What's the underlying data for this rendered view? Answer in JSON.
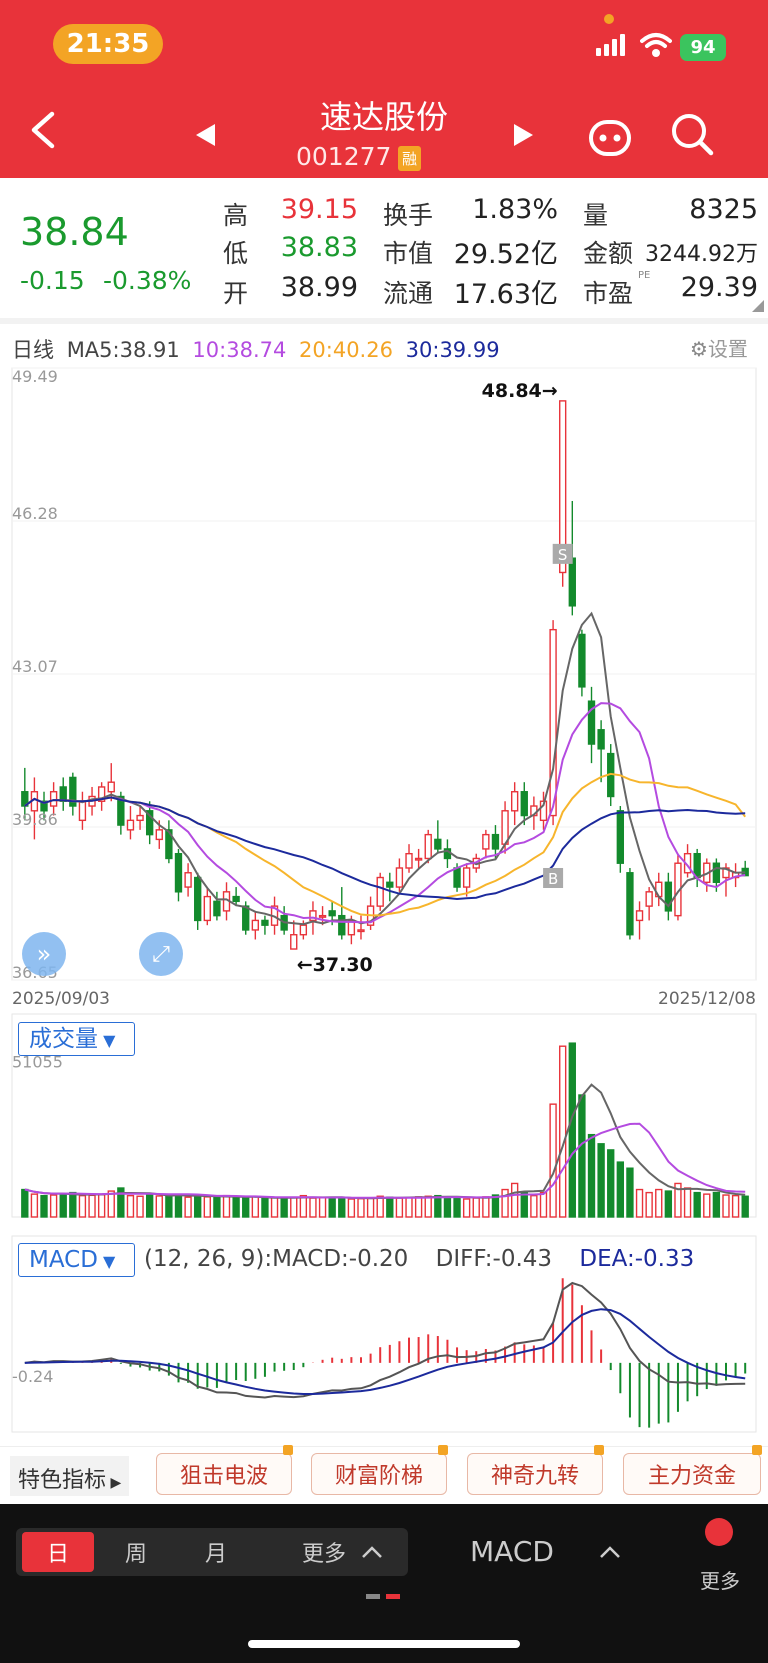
{
  "status": {
    "time": "21:35",
    "battery": "94"
  },
  "header": {
    "title": "速达股份",
    "code": "001277",
    "margin_badge": "融"
  },
  "quote": {
    "price": "38.84",
    "change": "-0.15",
    "change_pct": "-0.38%",
    "high_label": "高",
    "high": "39.15",
    "low_label": "低",
    "low": "38.83",
    "open_label": "开",
    "open": "38.99",
    "turnover_label": "换手",
    "turnover": "1.83%",
    "mktcap_label": "市值",
    "mktcap": "29.52亿",
    "float_label": "流通",
    "float": "17.63亿",
    "vol_label": "量",
    "vol": "8325",
    "amount_label": "金额",
    "amount": "3244.92万",
    "pe_label": "市盈",
    "pe_sup": "PE",
    "pe": "29.39"
  },
  "ma_legend": {
    "period": "日线",
    "ma5": "MA5:38.91",
    "ma10": "10:38.74",
    "ma20": "20:40.26",
    "ma30": "30:39.99",
    "settings": "设置"
  },
  "colors": {
    "up": "#e8333a",
    "down": "#138a2c",
    "ma5": "#666666",
    "ma10": "#b44be0",
    "ma20": "#f7b52c",
    "ma30": "#1c2a9c",
    "diff": "#555555",
    "dea": "#1c2a9c"
  },
  "chart_data": {
    "type": "candlestick",
    "y_ticks": [
      "49.49",
      "46.28",
      "43.07",
      "39.86",
      "36.65"
    ],
    "ylim": [
      36.65,
      49.49
    ],
    "x_start": "2025/09/03",
    "x_end": "2025/12/08",
    "high_mark": "48.84→",
    "low_mark": "←37.30",
    "sell_marker": "S",
    "buy_marker": "B",
    "candles": [
      [
        40.6,
        40.3,
        41.1,
        40.0
      ],
      [
        40.2,
        40.6,
        40.9,
        39.6
      ],
      [
        40.4,
        40.2,
        40.6,
        40.0
      ],
      [
        40.3,
        40.6,
        40.8,
        40.1
      ],
      [
        40.7,
        40.4,
        40.9,
        40.2
      ],
      [
        40.9,
        40.3,
        41.0,
        40.1
      ],
      [
        40.0,
        40.4,
        40.6,
        39.8
      ],
      [
        40.3,
        40.5,
        40.7,
        40.1
      ],
      [
        40.4,
        40.7,
        40.8,
        40.2
      ],
      [
        40.6,
        40.8,
        41.2,
        40.4
      ],
      [
        40.5,
        39.9,
        40.6,
        39.7
      ],
      [
        39.8,
        40.0,
        40.3,
        39.6
      ],
      [
        40.0,
        40.1,
        40.3,
        39.8
      ],
      [
        40.2,
        39.7,
        40.4,
        39.5
      ],
      [
        39.6,
        39.8,
        40.0,
        39.4
      ],
      [
        39.8,
        39.2,
        40.0,
        39.1
      ],
      [
        39.3,
        38.5,
        39.4,
        38.3
      ],
      [
        38.6,
        38.9,
        39.1,
        38.4
      ],
      [
        38.8,
        37.9,
        38.9,
        37.7
      ],
      [
        37.9,
        38.4,
        38.6,
        37.8
      ],
      [
        38.3,
        38.0,
        38.5,
        37.9
      ],
      [
        38.1,
        38.5,
        38.7,
        37.9
      ],
      [
        38.4,
        38.3,
        38.6,
        38.2
      ],
      [
        38.2,
        37.7,
        38.3,
        37.6
      ],
      [
        37.7,
        37.9,
        38.1,
        37.5
      ],
      [
        37.9,
        37.8,
        38.0,
        37.6
      ],
      [
        37.8,
        38.2,
        38.4,
        37.6
      ],
      [
        38.0,
        37.7,
        38.2,
        37.6
      ],
      [
        37.3,
        37.6,
        37.9,
        37.3
      ],
      [
        37.6,
        37.8,
        37.9,
        37.5
      ],
      [
        37.9,
        38.1,
        38.3,
        37.6
      ],
      [
        38.0,
        38.0,
        38.2,
        37.8
      ],
      [
        38.1,
        38.0,
        38.3,
        37.8
      ],
      [
        38.0,
        37.6,
        38.6,
        37.5
      ],
      [
        37.6,
        37.9,
        38.0,
        37.4
      ],
      [
        37.7,
        37.7,
        38.0,
        37.5
      ],
      [
        37.8,
        38.2,
        38.4,
        37.7
      ],
      [
        38.2,
        38.8,
        38.9,
        38.1
      ],
      [
        38.7,
        38.6,
        38.9,
        38.3
      ],
      [
        38.6,
        39.0,
        39.2,
        38.5
      ],
      [
        39.0,
        39.3,
        39.5,
        38.9
      ],
      [
        39.2,
        39.2,
        39.4,
        39.0
      ],
      [
        39.2,
        39.7,
        39.8,
        39.1
      ],
      [
        39.6,
        39.4,
        40.0,
        39.3
      ],
      [
        39.4,
        39.2,
        39.6,
        39.0
      ],
      [
        39.0,
        38.6,
        39.1,
        38.5
      ],
      [
        38.6,
        39.0,
        39.1,
        38.4
      ],
      [
        39.0,
        39.2,
        39.3,
        38.9
      ],
      [
        39.4,
        39.7,
        39.8,
        39.2
      ],
      [
        39.7,
        39.4,
        39.9,
        39.2
      ],
      [
        39.5,
        40.2,
        40.4,
        39.3
      ],
      [
        40.2,
        40.6,
        40.8,
        39.9
      ],
      [
        40.6,
        40.1,
        40.8,
        39.9
      ],
      [
        40.1,
        40.3,
        40.5,
        39.8
      ],
      [
        40.0,
        40.4,
        40.6,
        39.8
      ],
      [
        40.1,
        44.0,
        44.2,
        39.9
      ],
      [
        45.2,
        48.8,
        48.8,
        44.9
      ],
      [
        45.5,
        44.5,
        46.7,
        44.3
      ],
      [
        43.9,
        42.8,
        44.0,
        42.6
      ],
      [
        42.5,
        41.6,
        42.8,
        41.2
      ],
      [
        41.9,
        41.5,
        42.1,
        40.8
      ],
      [
        41.4,
        40.5,
        41.6,
        40.3
      ],
      [
        40.2,
        39.1,
        40.3,
        38.9
      ],
      [
        38.9,
        37.6,
        39.0,
        37.5
      ],
      [
        37.9,
        38.1,
        38.3,
        37.5
      ],
      [
        38.2,
        38.5,
        38.6,
        37.9
      ],
      [
        38.4,
        38.7,
        38.9,
        38.2
      ],
      [
        38.7,
        38.1,
        38.9,
        37.9
      ],
      [
        38.0,
        39.1,
        39.3,
        37.9
      ],
      [
        38.9,
        39.3,
        39.5,
        38.8
      ],
      [
        39.3,
        38.8,
        39.4,
        38.6
      ],
      [
        38.7,
        39.1,
        39.2,
        38.5
      ],
      [
        39.1,
        38.7,
        39.2,
        38.5
      ],
      [
        38.8,
        39.0,
        39.1,
        38.4
      ],
      [
        38.8,
        38.9,
        39.1,
        38.6
      ],
      [
        38.99,
        38.84,
        39.15,
        38.83
      ]
    ],
    "ma5": [
      39.6,
      39.62,
      39.64,
      39.66,
      39.68,
      39.7,
      39.73,
      39.76,
      39.79,
      39.82,
      39.85,
      39.88,
      39.9,
      39.92,
      39.94,
      39.96,
      39.98,
      40.0,
      40.02,
      40.04,
      40.06,
      40.08,
      40.1,
      40.12,
      40.14,
      40.16,
      40.18,
      40.2,
      40.22,
      40.24,
      40.26,
      40.28,
      40.3,
      40.32,
      40.34,
      40.36,
      40.38,
      40.4,
      40.42,
      40.44,
      40.46,
      40.48,
      40.5,
      40.52,
      40.54,
      40.56,
      40.58,
      40.6,
      40.62,
      40.64,
      40.66,
      40.68,
      40.7,
      40.72,
      40.74,
      40.76,
      40.78,
      40.8,
      40.82,
      40.84,
      40.86,
      40.88,
      40.9,
      40.92,
      40.94,
      40.96,
      40.98,
      41.0,
      41.02,
      41.04,
      41.06,
      41.08,
      41.1,
      41.12,
      41.14,
      41.16
    ],
    "ma10": [],
    "ma20": [],
    "ma30": [],
    "volume_label": "成交量",
    "volume_tick": "51055",
    "volume": [
      9000,
      7500,
      7000,
      7200,
      7600,
      8000,
      7000,
      7100,
      7300,
      8500,
      9500,
      7000,
      6800,
      7200,
      6900,
      7200,
      7400,
      6500,
      6800,
      6600,
      6700,
      7000,
      6400,
      6200,
      6800,
      6000,
      6300,
      6100,
      6500,
      7000,
      6200,
      6300,
      6500,
      6400,
      5900,
      6000,
      6100,
      6800,
      6500,
      6200,
      6300,
      6600,
      6800,
      7000,
      6500,
      6400,
      5900,
      6200,
      6600,
      7200,
      9000,
      11000,
      8000,
      7000,
      8000,
      37000,
      56000,
      57000,
      40000,
      27000,
      24000,
      22000,
      18000,
      16000,
      9000,
      8000,
      9000,
      8500,
      11000,
      9500,
      8000,
      7500,
      8000,
      7200,
      7000,
      6800
    ],
    "macd_label": "MACD",
    "macd_params": "(12, 26, 9):MACD:-0.20",
    "diff_text": "DIFF:-0.43",
    "dea_text": "DEA:-0.33",
    "macd_tick": "-0.24"
  },
  "indicators": {
    "label": "特色指标",
    "items": [
      "狙击电波",
      "财富阶梯",
      "神奇九转",
      "主力资金"
    ]
  },
  "bottom": {
    "tabs": [
      "日",
      "周",
      "月",
      "更多"
    ],
    "indicator": "MACD",
    "more": "更多"
  }
}
